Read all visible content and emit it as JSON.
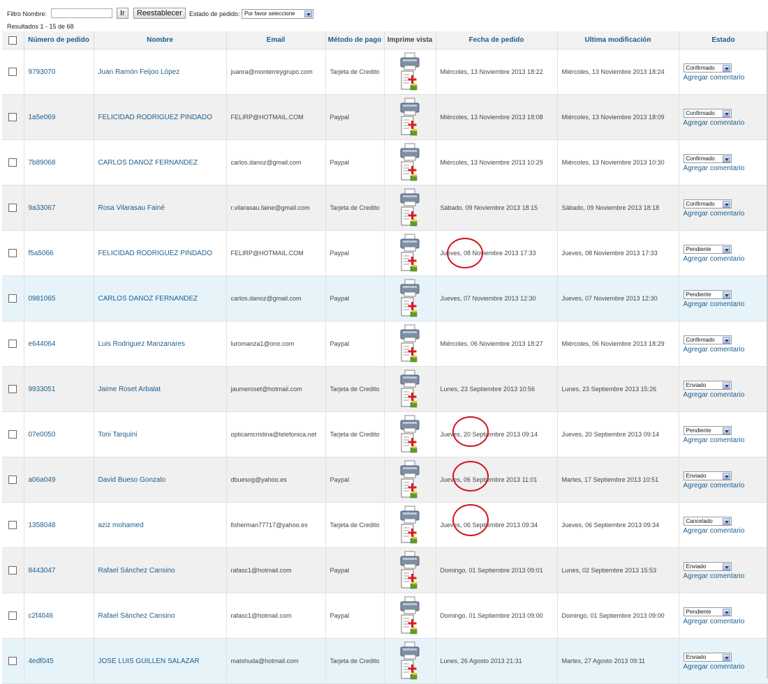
{
  "filters": {
    "name_label": "Filtro Nombre:",
    "name_value": "",
    "go_label": "Ir",
    "reset_label": "Reestablecer",
    "status_label": "Estado de pedido:",
    "status_value": "Por favor seleccione"
  },
  "results_text": "Resultados 1 - 15 de 68",
  "columns": [
    "Número de pedido",
    "Nombre",
    "Email",
    "Método de pago",
    "Imprime vista",
    "Fecha de pedido",
    "Ultima modificación",
    "Estado"
  ],
  "comment_label": "Agregar comentario",
  "icons": {
    "print": "printer-icon",
    "document": "document-add-icon"
  },
  "colors": {
    "link": "#1f5d8c",
    "highlight_row": "#e6f4fa",
    "annotation_circle": "#d0131e"
  },
  "orders": [
    {
      "number": "9793070",
      "name": "Juan Ramón Feijoo López",
      "email": "juanra@monterreygrupo.com",
      "payment": "Tarjeta de Credito",
      "date": "Miércoles, 13 Noviembre 2013 18:22",
      "modified": "Miércoles, 13 Noviembre 2013 18:24",
      "status": "Confirmado"
    },
    {
      "number": "1a5e069",
      "name": "FELICIDAD RODRIGUEZ PINDADO",
      "email": "FELIRP@HOTMAIL.COM",
      "payment": "Paypal",
      "date": "Miércoles, 13 Noviembre 2013 18:08",
      "modified": "Miércoles, 13 Noviembre 2013 18:09",
      "status": "Confirmado"
    },
    {
      "number": "7b89068",
      "name": "CARLOS DANOZ FERNANDEZ",
      "email": "carlos.danoz@gmail.com",
      "payment": "Paypal",
      "date": "Miércoles, 13 Noviembre 2013 10:29",
      "modified": "Miércoles, 13 Noviembre 2013 10:30",
      "status": "Confirmado"
    },
    {
      "number": "9a33067",
      "name": "Rosa Vilarasau Fainé",
      "email": "r.vilarasau.faine@gmail.com",
      "payment": "Tarjeta de Credito",
      "date": "Sábado, 09 Noviembre 2013 18:15",
      "modified": "Sábado, 09 Noviembre 2013 18:18",
      "status": "Confirmado"
    },
    {
      "number": "f5a5066",
      "name": "FELICIDAD RODRIGUEZ PINDADO",
      "email": "FELIRP@HOTMAIL.COM",
      "payment": "Paypal",
      "date": "Jueves, 08 Noviembre 2013 17:33",
      "modified": "Jueves, 08 Noviembre 2013 17:33",
      "status": "Pendiente"
    },
    {
      "number": "0981065",
      "name": "CARLOS DANOZ FERNANDEZ",
      "email": "carlos.danoz@gmail.com",
      "payment": "Paypal",
      "date": "Jueves, 07 Noviembre 2013 12:30",
      "modified": "Jueves, 07 Noviembre 2013 12:30",
      "status": "Pendiente"
    },
    {
      "number": "e644064",
      "name": "Luis Rodriguez Manzanares",
      "email": "luromanza1@ono.com",
      "payment": "Paypal",
      "date": "Miércoles, 06 Noviembre 2013 18:27",
      "modified": "Miércoles, 06 Noviembre 2013 18:29",
      "status": "Confirmado"
    },
    {
      "number": "9933051",
      "name": "Jaime Roset Arbalat",
      "email": "jaumeroset@hotmail.com",
      "payment": "Tarjeta de Credito",
      "date": "Lunes, 23 Septiembre 2013 10:56",
      "modified": "Lunes, 23 Septiembre 2013 15:26",
      "status": "Enviado"
    },
    {
      "number": "07e0050",
      "name": "Toni Tarquini",
      "email": "opticamcristina@telefonica.net",
      "payment": "Tarjeta de Credito",
      "date": "Jueves, 20 Septiembre 2013 09:14",
      "modified": "Jueves, 20 Septiembre 2013 09:14",
      "status": "Pendiente"
    },
    {
      "number": "a06a049",
      "name": "David Bueso Gonzalo",
      "email": "dbuesog@yahoo.es",
      "payment": "Paypal",
      "date": "Jueves, 06 Septiembre 2013 11:01",
      "modified": "Martes, 17 Septiembre 2013 10:51",
      "status": "Enviado"
    },
    {
      "number": "1358048",
      "name": "aziz mohamed",
      "email": "fisherman77717@yahoo.es",
      "payment": "Tarjeta de Credito",
      "date": "Jueves, 06 Septiembre 2013 09:34",
      "modified": "Jueves, 06 Septiembre 2013 09:34",
      "status": "Cancelado"
    },
    {
      "number": "8443047",
      "name": "Rafael Sánchez Cansino",
      "email": "rafasc1@hotmail.com",
      "payment": "Paypal",
      "date": "Domingo, 01 Septiembre 2013 09:01",
      "modified": "Lunes, 02 Septiembre 2013 15:53",
      "status": "Enviado"
    },
    {
      "number": "c2f4046",
      "name": "Rafael Sánchez Cansino",
      "email": "rafasc1@hotmail.com",
      "payment": "Paypal",
      "date": "Domingo, 01 Septiembre 2013 09:00",
      "modified": "Domingo, 01 Septiembre 2013 09:00",
      "status": "Pendiente"
    },
    {
      "number": "4edf045",
      "name": "JOSE LUIS GUILLEN SALAZAR",
      "email": "matshuda@hotmail.com",
      "payment": "Tarjeta de Credito",
      "date": "Lunes, 26 Agosto 2013 21:31",
      "modified": "Martes, 27 Agosto 2013 09:11",
      "status": "Enviado"
    }
  ]
}
